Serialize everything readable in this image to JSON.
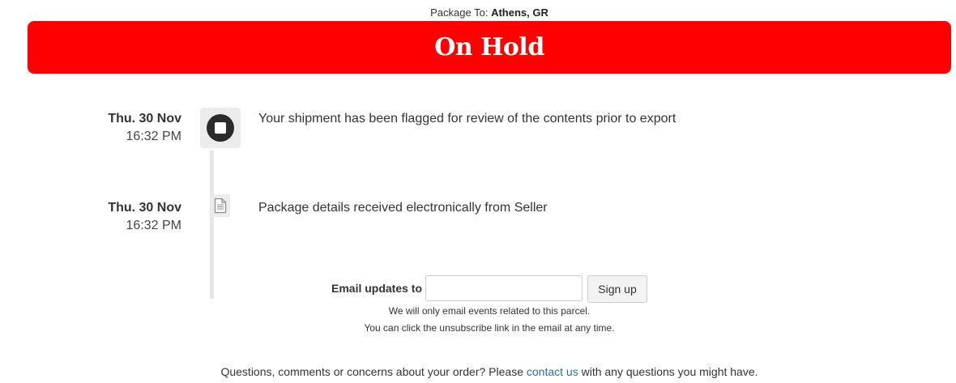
{
  "destination": {
    "prefix": "Package To:",
    "location": "Athens, GR"
  },
  "status": {
    "label": "On Hold",
    "color": "#ff0000"
  },
  "events": [
    {
      "day": "Thu. 30 Nov",
      "time": "16:32 PM",
      "description": "Your shipment has been flagged for review of the contents prior to export",
      "icon": "stop-circle-icon"
    },
    {
      "day": "Thu. 30 Nov",
      "time": "16:32 PM",
      "description": "Package details received electronically from Seller",
      "icon": "document-icon"
    }
  ],
  "email_updates": {
    "label": "Email updates to",
    "input_value": "",
    "placeholder": "",
    "button_label": "Sign up",
    "note_line1": "We will only email events related to this parcel.",
    "note_line2": "You can click the unsubscribe link in the email at any time."
  },
  "footer": {
    "text_before": "Questions, comments or concerns about your order? Please ",
    "link_text": "contact us",
    "text_after": " with any questions you might have.",
    "link_color": "#2a6f97"
  }
}
